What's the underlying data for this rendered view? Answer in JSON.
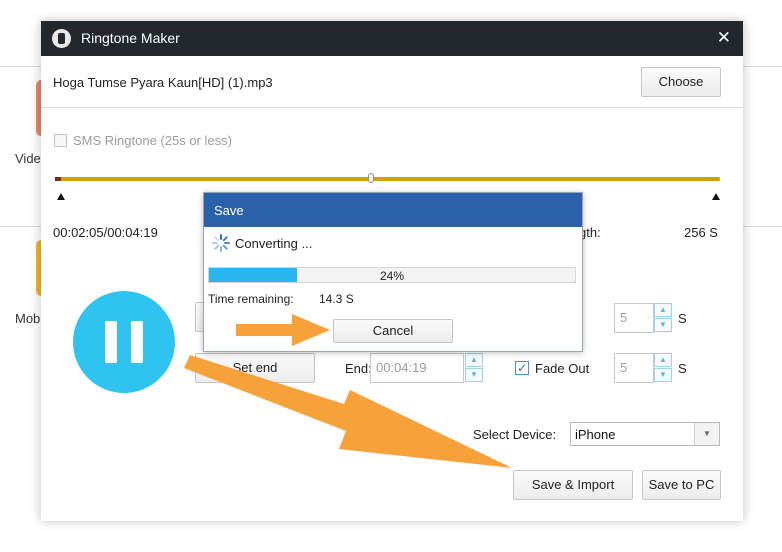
{
  "background": {
    "label_video": "Vide",
    "label_mobile": "Mobi"
  },
  "dialog": {
    "title": "Ringtone Maker",
    "close_glyph": "✕",
    "file_name": "Hoga Tumse Pyara Kaun[HD] (1).mp3",
    "choose_label": "Choose",
    "sms_label": "SMS Ringtone (25s or less)",
    "time_position": "00:02:05/00:04:19",
    "length_label": "gth:",
    "length_value": "256 S",
    "playhead_fraction": 0.47,
    "set_end_label": "Set end",
    "end_label": "End:",
    "end_value": "00:04:19",
    "fade_out_label": "Fade Out",
    "fade_out_checked": true,
    "fade_in_value": "5",
    "fade_out_value": "5",
    "seconds_unit": "S",
    "select_device_label": "Select Device:",
    "device_value": "iPhone",
    "save_import_label": "Save & Import",
    "save_pc_label": "Save to PC"
  },
  "save_modal": {
    "title": "Save",
    "status": "Converting ...",
    "progress_percent": 24,
    "progress_text": "24%",
    "time_remaining_label": "Time remaining:",
    "time_remaining_value": "14.3 S",
    "cancel_label": "Cancel"
  },
  "colors": {
    "titlebar": "#23272e",
    "modal_header": "#2a61a8",
    "progress_fill": "#29b6ef",
    "timeline": "#d2a000",
    "arrow": "#f7a13a",
    "pause_circle": "#2fc4f0"
  },
  "icons": {
    "app": "ringtone-app-icon",
    "close": "close-icon",
    "spinner": "loading-spinner-icon",
    "pause": "pause-icon",
    "dropdown": "chevron-down-icon"
  }
}
